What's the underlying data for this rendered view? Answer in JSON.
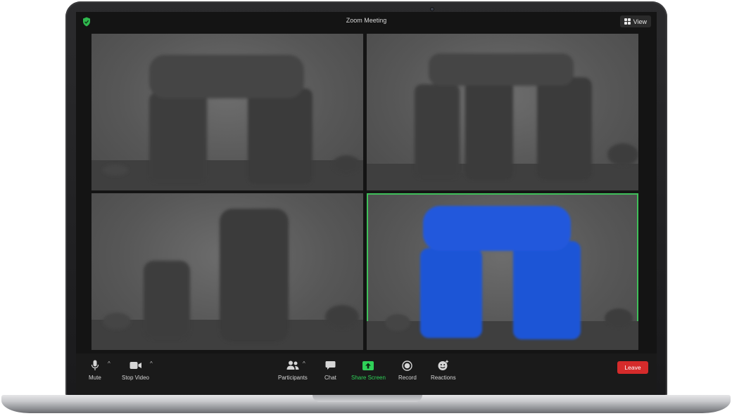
{
  "window": {
    "title": "Zoom Meeting"
  },
  "header": {
    "view_label": "View",
    "security_icon": "shield-check-icon",
    "view_icon": "grid-icon"
  },
  "toolbar": {
    "mute_label": "Mute",
    "stop_video_label": "Stop Video",
    "participants_label": "Participants",
    "chat_label": "Chat",
    "share_screen_label": "Share Screen",
    "record_label": "Record",
    "reactions_label": "Reactions",
    "leave_label": "Leave",
    "caret": "^"
  },
  "colors": {
    "accent_green": "#2fd158",
    "active_speaker_border": "#3fbf5a",
    "leave_red": "#d52b2b",
    "highlight_blue": "#1f55d6"
  }
}
